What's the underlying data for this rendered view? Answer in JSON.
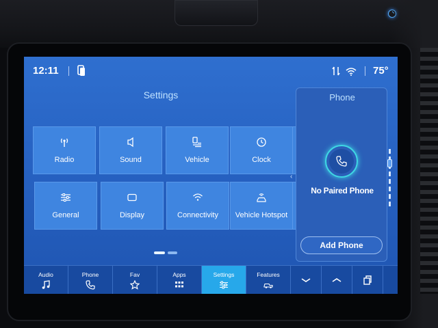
{
  "status_bar": {
    "time": "12:11",
    "temperature": "75°"
  },
  "settings": {
    "title": "Settings",
    "tiles": [
      {
        "label": "Radio",
        "icon": "radio-icon"
      },
      {
        "label": "Sound",
        "icon": "speaker-icon"
      },
      {
        "label": "Vehicle",
        "icon": "vehicle-settings-icon"
      },
      {
        "label": "Clock",
        "icon": "clock-icon"
      },
      {
        "label": "General",
        "icon": "sliders-icon"
      },
      {
        "label": "Display",
        "icon": "display-icon"
      },
      {
        "label": "Connectivity",
        "icon": "wifi-icon"
      },
      {
        "label": "Vehicle Hotspot",
        "icon": "hotspot-icon"
      }
    ],
    "page_count": 2,
    "active_page": 1
  },
  "phone_panel": {
    "title": "Phone",
    "status": "No Paired Phone",
    "add_button": "Add Phone"
  },
  "bottom_nav": {
    "items": [
      {
        "label": "Audio",
        "icon": "music-note-icon"
      },
      {
        "label": "Phone",
        "icon": "phone-icon"
      },
      {
        "label": "Fav",
        "icon": "star-icon"
      },
      {
        "label": "Apps",
        "icon": "apps-grid-icon"
      },
      {
        "label": "Settings",
        "icon": "settings-sliders-icon",
        "active": true
      },
      {
        "label": "Features",
        "icon": "truck-icon"
      }
    ],
    "controls": [
      "chevron-down-icon",
      "chevron-up-icon",
      "copy-icon"
    ]
  },
  "colors": {
    "screen_bg": "#2762c2",
    "tile_bg": "#3f85e0",
    "nav_bg": "#184aa0",
    "active_tab": "#27a8ea",
    "accent_cyan": "#3fd7e4",
    "title_text": "#bfe2ff"
  }
}
